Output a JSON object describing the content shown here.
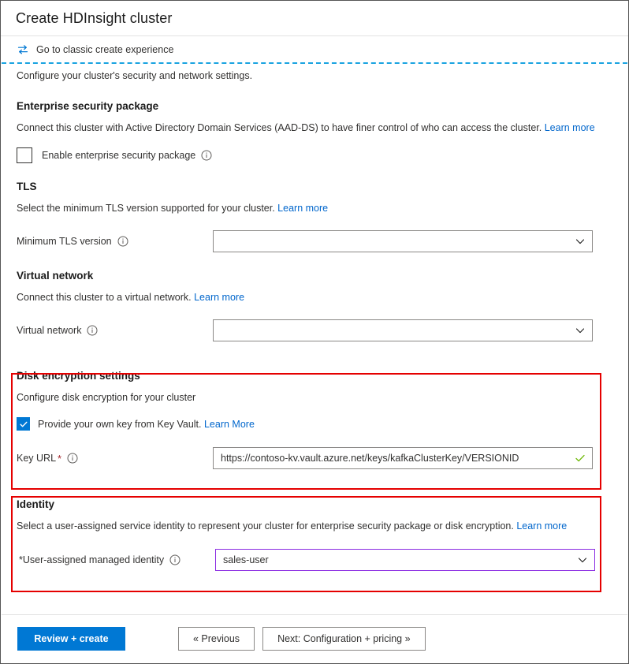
{
  "window": {
    "title": "Create HDInsight cluster"
  },
  "classic_bar": {
    "icon": "swap-arrows-icon",
    "label": "Go to classic create experience"
  },
  "intro_text": "Configure your cluster's security and network settings.",
  "sections": {
    "enterprise_security": {
      "heading": "Enterprise security package",
      "description": "Connect this cluster with Active Directory Domain Services (AAD-DS) to have finer control of who can access the cluster. ",
      "learn_more": "Learn more",
      "checkbox_label": "Enable enterprise security package",
      "checkbox_checked": false,
      "info_icon": "info-icon"
    },
    "tls": {
      "heading": "TLS",
      "description": "Select the minimum TLS version supported for your cluster. ",
      "learn_more": "Learn more",
      "field_label": "Minimum TLS version",
      "field_value": "",
      "info_icon": "info-icon",
      "chevron_icon": "chevron-down-icon"
    },
    "virtual_network": {
      "heading": "Virtual network",
      "description": "Connect this cluster to a virtual network. ",
      "learn_more": "Learn more",
      "field_label": "Virtual network",
      "field_value": "",
      "info_icon": "info-icon",
      "chevron_icon": "chevron-down-icon"
    },
    "disk_encryption": {
      "heading": "Disk encryption settings",
      "description": "Configure disk encryption for your cluster",
      "checkbox_label": "Provide your own key from Key Vault.",
      "checkbox_learn_more": "Learn More",
      "checkbox_checked": true,
      "field_label": "Key URL",
      "field_required_marker": "*",
      "field_value": "https://contoso-kv.vault.azure.net/keys/kafkaClusterKey/VERSIONID",
      "valid_icon": "green-check-icon",
      "info_icon": "info-icon",
      "highlighted": true
    },
    "identity": {
      "heading": "Identity",
      "description": "Select a user-assigned service identity to represent your cluster for enterprise security package or disk encryption. ",
      "learn_more": "Learn more",
      "field_label": "*User-assigned managed identity",
      "field_value": "sales-user",
      "info_icon": "info-icon",
      "chevron_icon": "chevron-down-icon",
      "highlighted": true
    }
  },
  "footer": {
    "review_create": "Review + create",
    "previous": "« Previous",
    "next": "Next: Configuration + pricing »"
  },
  "colors": {
    "accent": "#0078d4",
    "link": "#0066cc",
    "highlight": "#e50000",
    "purple_border": "#8a2be2",
    "valid_green": "#6bb700",
    "required_star": "#a4262c",
    "dashed_line": "#1aa3e0"
  }
}
